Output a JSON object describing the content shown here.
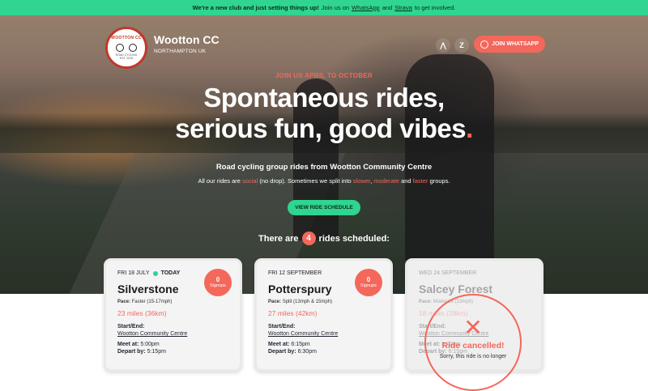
{
  "banner": {
    "text_strong": "We're a new club and just setting things up!",
    "text_mid": "Join us on",
    "whatsapp_link": "WhatsApp",
    "and": "and",
    "strava_link": "Strava",
    "text_end": "to get involved."
  },
  "header": {
    "logo_ring_text": "WOOTTON CC",
    "logo_sub_text": "ROAD CYCLING",
    "logo_est_text": "EST. 2025",
    "club_name": "Wootton CC",
    "club_location": "NORTHAMPTON UK",
    "strava_icon_glyph": "⋀",
    "zwift_icon_glyph": "Z",
    "join_whatsapp_label": "JOIN WHATSAPP"
  },
  "hero": {
    "eyebrow": "JOIN US APRIL TO OCTOBER",
    "headline_line1": "Spontaneous rides,",
    "headline_line2": "serious fun, good vibes",
    "headline_dot": ".",
    "subtitle": "Road cycling group rides from Wootton Community Centre",
    "desc_pre": "All our rides are",
    "desc_social": "social",
    "desc_mid1": "(no drop). Sometimes we split into",
    "desc_slower": "slower",
    "desc_comma": ",",
    "desc_moderate": "moderate",
    "desc_and": "and",
    "desc_faster": "faster",
    "desc_end": "groups.",
    "cta_label": "VIEW RIDE SCHEDULE",
    "count_pre": "There are",
    "count_value": "4",
    "count_post": "rides scheduled:"
  },
  "rides": [
    {
      "date": "FRI 18 JULY",
      "today_label": "TODAY",
      "title": "Silverstone",
      "pace_label": "Pace:",
      "pace_value": "Faster (15-17mph)",
      "distance": "23 miles (36km)",
      "start_end_label": "Start/End:",
      "start_end_value": "Wootton Community Centre",
      "meet_label": "Meet at:",
      "meet_value": "5:00pm",
      "depart_label": "Depart by:",
      "depart_value": "5:15pm",
      "signups_count": "0",
      "signups_label": "Signups"
    },
    {
      "date": "FRI 12 SEPTEMBER",
      "title": "Potterspury",
      "pace_label": "Pace:",
      "pace_value": "Split (13mph & 15mph)",
      "distance": "27 miles (42km)",
      "start_end_label": "Start/End:",
      "start_end_value": "Wootton Community Centre",
      "meet_label": "Meet at:",
      "meet_value": "6:15pm",
      "depart_label": "Depart by:",
      "depart_value": "6:30pm",
      "signups_count": "0",
      "signups_label": "Signups"
    },
    {
      "date": "WED 24 SEPTEMBER",
      "title": "Salcey Forest",
      "pace_label": "Pace:",
      "pace_value": "Moderate (13mph)",
      "distance": "18 miles (28km)",
      "start_end_label": "Start/End:",
      "start_end_value": "Wootton Community Centre",
      "meet_label": "Meet at:",
      "meet_value": "6:00pm",
      "depart_label": "Depart by:",
      "depart_value": "6:15pm",
      "cancelled_icon": "✕",
      "cancelled_title": "Ride cancelled!",
      "cancelled_msg": "Sorry, this ride is no longer"
    }
  ],
  "colors": {
    "accent_green": "#2fd590",
    "accent_coral": "#f4675b"
  }
}
